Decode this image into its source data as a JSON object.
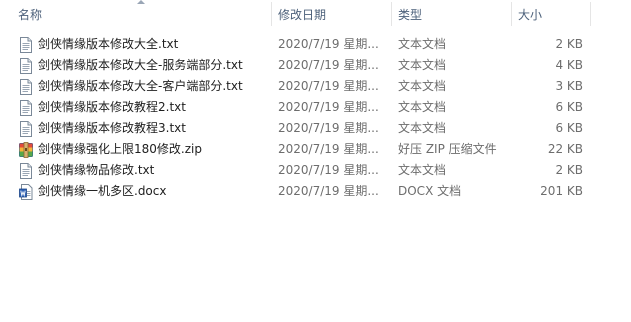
{
  "columns": {
    "name": "名称",
    "date": "修改日期",
    "type": "类型",
    "size": "大小"
  },
  "files": [
    {
      "name": "剑侠情缘版本修改大全.txt",
      "date": "2020/7/19 星期...",
      "type": "文本文档",
      "size": "2 KB",
      "icon": "text-file-icon"
    },
    {
      "name": "剑侠情缘版本修改大全-服务端部分.txt",
      "date": "2020/7/19 星期...",
      "type": "文本文档",
      "size": "4 KB",
      "icon": "text-file-icon"
    },
    {
      "name": "剑侠情缘版本修改大全-客户端部分.txt",
      "date": "2020/7/19 星期...",
      "type": "文本文档",
      "size": "3 KB",
      "icon": "text-file-icon"
    },
    {
      "name": "剑侠情缘版本修改教程2.txt",
      "date": "2020/7/19 星期...",
      "type": "文本文档",
      "size": "6 KB",
      "icon": "text-file-icon"
    },
    {
      "name": "剑侠情缘版本修改教程3.txt",
      "date": "2020/7/19 星期...",
      "type": "文本文档",
      "size": "6 KB",
      "icon": "text-file-icon"
    },
    {
      "name": "剑侠情缘强化上限180修改.zip",
      "date": "2020/7/19 星期...",
      "type": "好压 ZIP 压缩文件",
      "size": "22 KB",
      "icon": "zip-archive-icon"
    },
    {
      "name": "剑侠情缘物品修改.txt",
      "date": "2020/7/19 星期...",
      "type": "文本文档",
      "size": "2 KB",
      "icon": "text-file-icon"
    },
    {
      "name": "剑侠情缘一机多区.docx",
      "date": "2020/7/19 星期...",
      "type": "DOCX 文档",
      "size": "201 KB",
      "icon": "word-document-icon"
    }
  ]
}
